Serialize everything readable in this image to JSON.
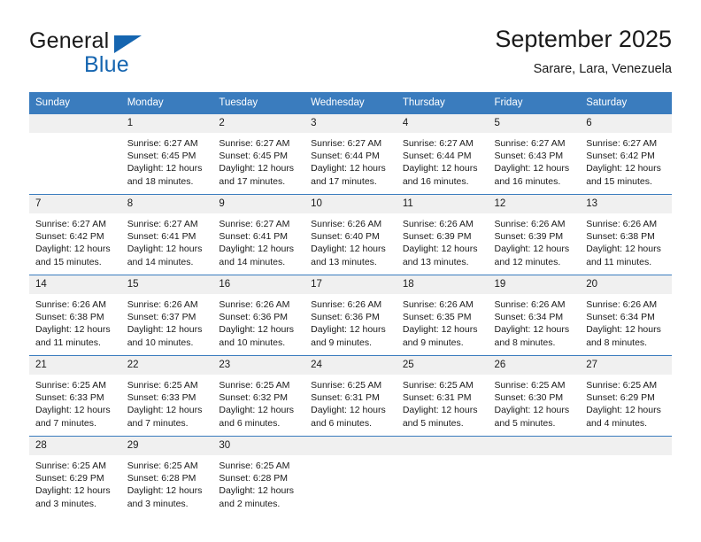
{
  "brand": {
    "name_top": "General",
    "name_bottom": "Blue",
    "accent_color": "#1565b0"
  },
  "header": {
    "title": "September 2025",
    "subtitle": "Sarare, Lara, Venezuela"
  },
  "calendar": {
    "header_bg": "#3a7cbe",
    "daynum_bg": "#f0f0f0",
    "weekdays": [
      "Sunday",
      "Monday",
      "Tuesday",
      "Wednesday",
      "Thursday",
      "Friday",
      "Saturday"
    ],
    "labels": {
      "sunrise": "Sunrise:",
      "sunset": "Sunset:",
      "daylight": "Daylight:"
    },
    "weeks": [
      [
        {
          "day": "",
          "sunrise": "",
          "sunset": "",
          "daylight_line1": "",
          "daylight_line2": ""
        },
        {
          "day": "1",
          "sunrise": "Sunrise: 6:27 AM",
          "sunset": "Sunset: 6:45 PM",
          "daylight_line1": "Daylight: 12 hours",
          "daylight_line2": "and 18 minutes."
        },
        {
          "day": "2",
          "sunrise": "Sunrise: 6:27 AM",
          "sunset": "Sunset: 6:45 PM",
          "daylight_line1": "Daylight: 12 hours",
          "daylight_line2": "and 17 minutes."
        },
        {
          "day": "3",
          "sunrise": "Sunrise: 6:27 AM",
          "sunset": "Sunset: 6:44 PM",
          "daylight_line1": "Daylight: 12 hours",
          "daylight_line2": "and 17 minutes."
        },
        {
          "day": "4",
          "sunrise": "Sunrise: 6:27 AM",
          "sunset": "Sunset: 6:44 PM",
          "daylight_line1": "Daylight: 12 hours",
          "daylight_line2": "and 16 minutes."
        },
        {
          "day": "5",
          "sunrise": "Sunrise: 6:27 AM",
          "sunset": "Sunset: 6:43 PM",
          "daylight_line1": "Daylight: 12 hours",
          "daylight_line2": "and 16 minutes."
        },
        {
          "day": "6",
          "sunrise": "Sunrise: 6:27 AM",
          "sunset": "Sunset: 6:42 PM",
          "daylight_line1": "Daylight: 12 hours",
          "daylight_line2": "and 15 minutes."
        }
      ],
      [
        {
          "day": "7",
          "sunrise": "Sunrise: 6:27 AM",
          "sunset": "Sunset: 6:42 PM",
          "daylight_line1": "Daylight: 12 hours",
          "daylight_line2": "and 15 minutes."
        },
        {
          "day": "8",
          "sunrise": "Sunrise: 6:27 AM",
          "sunset": "Sunset: 6:41 PM",
          "daylight_line1": "Daylight: 12 hours",
          "daylight_line2": "and 14 minutes."
        },
        {
          "day": "9",
          "sunrise": "Sunrise: 6:27 AM",
          "sunset": "Sunset: 6:41 PM",
          "daylight_line1": "Daylight: 12 hours",
          "daylight_line2": "and 14 minutes."
        },
        {
          "day": "10",
          "sunrise": "Sunrise: 6:26 AM",
          "sunset": "Sunset: 6:40 PM",
          "daylight_line1": "Daylight: 12 hours",
          "daylight_line2": "and 13 minutes."
        },
        {
          "day": "11",
          "sunrise": "Sunrise: 6:26 AM",
          "sunset": "Sunset: 6:39 PM",
          "daylight_line1": "Daylight: 12 hours",
          "daylight_line2": "and 13 minutes."
        },
        {
          "day": "12",
          "sunrise": "Sunrise: 6:26 AM",
          "sunset": "Sunset: 6:39 PM",
          "daylight_line1": "Daylight: 12 hours",
          "daylight_line2": "and 12 minutes."
        },
        {
          "day": "13",
          "sunrise": "Sunrise: 6:26 AM",
          "sunset": "Sunset: 6:38 PM",
          "daylight_line1": "Daylight: 12 hours",
          "daylight_line2": "and 11 minutes."
        }
      ],
      [
        {
          "day": "14",
          "sunrise": "Sunrise: 6:26 AM",
          "sunset": "Sunset: 6:38 PM",
          "daylight_line1": "Daylight: 12 hours",
          "daylight_line2": "and 11 minutes."
        },
        {
          "day": "15",
          "sunrise": "Sunrise: 6:26 AM",
          "sunset": "Sunset: 6:37 PM",
          "daylight_line1": "Daylight: 12 hours",
          "daylight_line2": "and 10 minutes."
        },
        {
          "day": "16",
          "sunrise": "Sunrise: 6:26 AM",
          "sunset": "Sunset: 6:36 PM",
          "daylight_line1": "Daylight: 12 hours",
          "daylight_line2": "and 10 minutes."
        },
        {
          "day": "17",
          "sunrise": "Sunrise: 6:26 AM",
          "sunset": "Sunset: 6:36 PM",
          "daylight_line1": "Daylight: 12 hours",
          "daylight_line2": "and 9 minutes."
        },
        {
          "day": "18",
          "sunrise": "Sunrise: 6:26 AM",
          "sunset": "Sunset: 6:35 PM",
          "daylight_line1": "Daylight: 12 hours",
          "daylight_line2": "and 9 minutes."
        },
        {
          "day": "19",
          "sunrise": "Sunrise: 6:26 AM",
          "sunset": "Sunset: 6:34 PM",
          "daylight_line1": "Daylight: 12 hours",
          "daylight_line2": "and 8 minutes."
        },
        {
          "day": "20",
          "sunrise": "Sunrise: 6:26 AM",
          "sunset": "Sunset: 6:34 PM",
          "daylight_line1": "Daylight: 12 hours",
          "daylight_line2": "and 8 minutes."
        }
      ],
      [
        {
          "day": "21",
          "sunrise": "Sunrise: 6:25 AM",
          "sunset": "Sunset: 6:33 PM",
          "daylight_line1": "Daylight: 12 hours",
          "daylight_line2": "and 7 minutes."
        },
        {
          "day": "22",
          "sunrise": "Sunrise: 6:25 AM",
          "sunset": "Sunset: 6:33 PM",
          "daylight_line1": "Daylight: 12 hours",
          "daylight_line2": "and 7 minutes."
        },
        {
          "day": "23",
          "sunrise": "Sunrise: 6:25 AM",
          "sunset": "Sunset: 6:32 PM",
          "daylight_line1": "Daylight: 12 hours",
          "daylight_line2": "and 6 minutes."
        },
        {
          "day": "24",
          "sunrise": "Sunrise: 6:25 AM",
          "sunset": "Sunset: 6:31 PM",
          "daylight_line1": "Daylight: 12 hours",
          "daylight_line2": "and 6 minutes."
        },
        {
          "day": "25",
          "sunrise": "Sunrise: 6:25 AM",
          "sunset": "Sunset: 6:31 PM",
          "daylight_line1": "Daylight: 12 hours",
          "daylight_line2": "and 5 minutes."
        },
        {
          "day": "26",
          "sunrise": "Sunrise: 6:25 AM",
          "sunset": "Sunset: 6:30 PM",
          "daylight_line1": "Daylight: 12 hours",
          "daylight_line2": "and 5 minutes."
        },
        {
          "day": "27",
          "sunrise": "Sunrise: 6:25 AM",
          "sunset": "Sunset: 6:29 PM",
          "daylight_line1": "Daylight: 12 hours",
          "daylight_line2": "and 4 minutes."
        }
      ],
      [
        {
          "day": "28",
          "sunrise": "Sunrise: 6:25 AM",
          "sunset": "Sunset: 6:29 PM",
          "daylight_line1": "Daylight: 12 hours",
          "daylight_line2": "and 3 minutes."
        },
        {
          "day": "29",
          "sunrise": "Sunrise: 6:25 AM",
          "sunset": "Sunset: 6:28 PM",
          "daylight_line1": "Daylight: 12 hours",
          "daylight_line2": "and 3 minutes."
        },
        {
          "day": "30",
          "sunrise": "Sunrise: 6:25 AM",
          "sunset": "Sunset: 6:28 PM",
          "daylight_line1": "Daylight: 12 hours",
          "daylight_line2": "and 2 minutes."
        },
        {
          "day": "",
          "sunrise": "",
          "sunset": "",
          "daylight_line1": "",
          "daylight_line2": ""
        },
        {
          "day": "",
          "sunrise": "",
          "sunset": "",
          "daylight_line1": "",
          "daylight_line2": ""
        },
        {
          "day": "",
          "sunrise": "",
          "sunset": "",
          "daylight_line1": "",
          "daylight_line2": ""
        },
        {
          "day": "",
          "sunrise": "",
          "sunset": "",
          "daylight_line1": "",
          "daylight_line2": ""
        }
      ]
    ]
  }
}
